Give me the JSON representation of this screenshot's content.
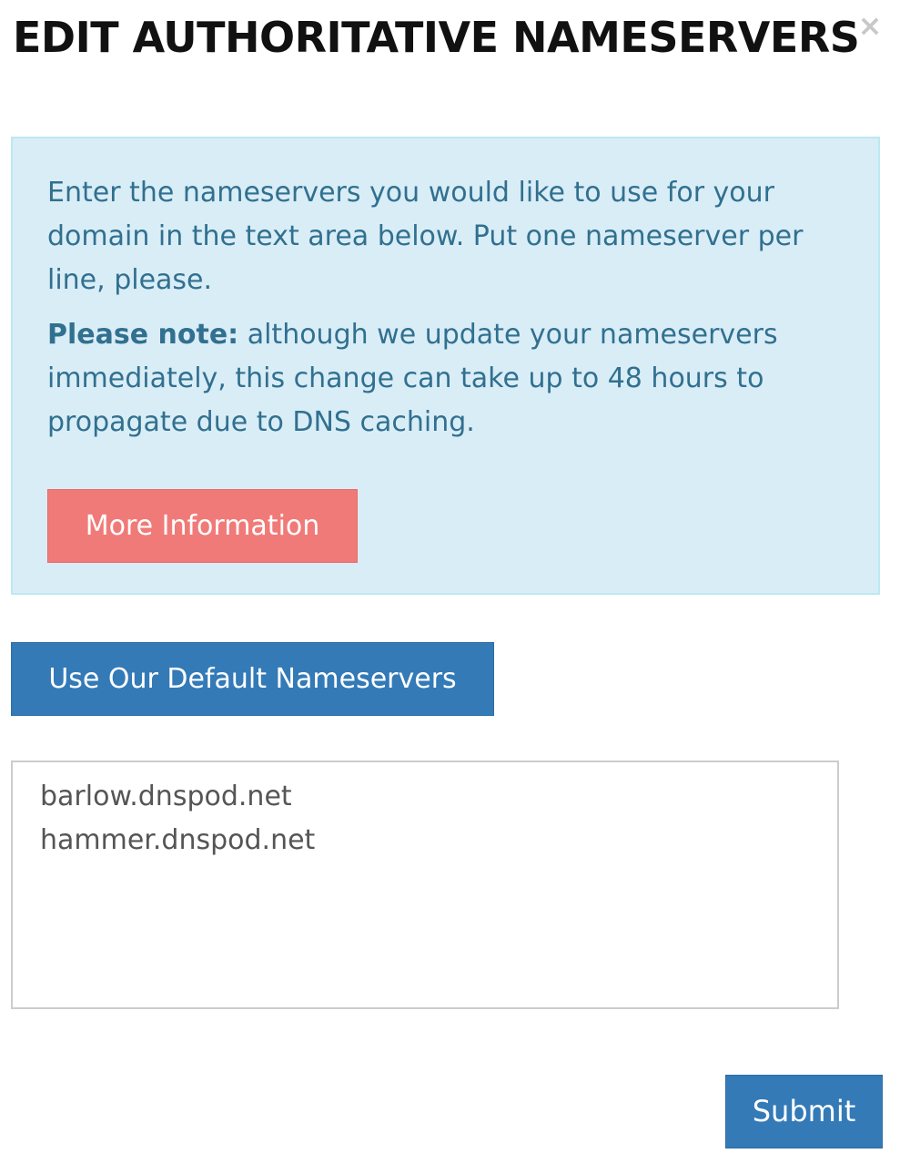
{
  "modal": {
    "title": "EDIT AUTHORITATIVE NAMESERVERS",
    "close_label": "×"
  },
  "info": {
    "intro": "Enter the nameservers you would like to use for your domain in the text area below. Put one nameserver per line, please.",
    "note_label": "Please note:",
    "note_text": " although we update your nameservers immediately, this change can take up to 48 hours to propagate due to DNS caching.",
    "more_info_label": "More Information"
  },
  "actions": {
    "default_nameservers_label": "Use Our Default Nameservers",
    "submit_label": "Submit"
  },
  "nameservers": {
    "value": "barlow.dnspod.net\nhammer.dnspod.net"
  },
  "colors": {
    "info_bg": "#d9edf7",
    "info_text": "#31708f",
    "more_info_button": "#f07a78",
    "primary_button": "#337ab7"
  },
  "icons": {
    "close": "close-icon"
  }
}
